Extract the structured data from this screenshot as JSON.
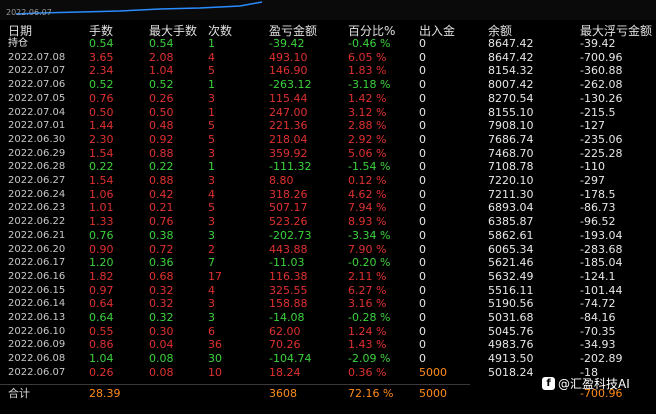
{
  "top_date": "2022.06.07",
  "headers": [
    "日期",
    "手数",
    "最大手数",
    "次数",
    "盈亏金额",
    "百分比%",
    "出入金",
    "余额",
    "最大浮亏金额"
  ],
  "rows": [
    {
      "date": "持仓",
      "lots": "0.54",
      "max_lots": "0.54",
      "count": "1",
      "pnl": "-39.42",
      "pct": "-0.46 %",
      "inout": "0",
      "balance": "8647.42",
      "max_float_loss": "-39.42",
      "pos": false
    },
    {
      "date": "2022.07.08",
      "lots": "3.65",
      "max_lots": "2.08",
      "count": "4",
      "pnl": "493.10",
      "pct": "6.05 %",
      "inout": "0",
      "balance": "8647.42",
      "max_float_loss": "-700.96",
      "pos": true
    },
    {
      "date": "2022.07.07",
      "lots": "2.34",
      "max_lots": "1.04",
      "count": "5",
      "pnl": "146.90",
      "pct": "1.83 %",
      "inout": "0",
      "balance": "8154.32",
      "max_float_loss": "-360.88",
      "pos": true
    },
    {
      "date": "2022.07.06",
      "lots": "0.52",
      "max_lots": "0.52",
      "count": "1",
      "pnl": "-263.12",
      "pct": "-3.18 %",
      "inout": "0",
      "balance": "8007.42",
      "max_float_loss": "-262.08",
      "pos": false
    },
    {
      "date": "2022.07.05",
      "lots": "0.76",
      "max_lots": "0.26",
      "count": "3",
      "pnl": "115.44",
      "pct": "1.42 %",
      "inout": "0",
      "balance": "8270.54",
      "max_float_loss": "-130.26",
      "pos": true
    },
    {
      "date": "2022.07.04",
      "lots": "0.50",
      "max_lots": "0.50",
      "count": "1",
      "pnl": "247.00",
      "pct": "3.12 %",
      "inout": "0",
      "balance": "8155.10",
      "max_float_loss": "-215.5",
      "pos": true
    },
    {
      "date": "2022.07.01",
      "lots": "1.44",
      "max_lots": "0.48",
      "count": "5",
      "pnl": "221.36",
      "pct": "2.88 %",
      "inout": "0",
      "balance": "7908.10",
      "max_float_loss": "-127",
      "pos": true
    },
    {
      "date": "2022.06.30",
      "lots": "2.30",
      "max_lots": "0.92",
      "count": "5",
      "pnl": "218.04",
      "pct": "2.92 %",
      "inout": "0",
      "balance": "7686.74",
      "max_float_loss": "-235.06",
      "pos": true
    },
    {
      "date": "2022.06.29",
      "lots": "1.54",
      "max_lots": "0.88",
      "count": "3",
      "pnl": "359.92",
      "pct": "5.06 %",
      "inout": "0",
      "balance": "7468.70",
      "max_float_loss": "-225.28",
      "pos": true
    },
    {
      "date": "2022.06.28",
      "lots": "0.22",
      "max_lots": "0.22",
      "count": "1",
      "pnl": "-111.32",
      "pct": "-1.54 %",
      "inout": "0",
      "balance": "7108.78",
      "max_float_loss": "-110",
      "pos": false
    },
    {
      "date": "2022.06.27",
      "lots": "1.54",
      "max_lots": "0.88",
      "count": "3",
      "pnl": "8.80",
      "pct": "0.12 %",
      "inout": "0",
      "balance": "7220.10",
      "max_float_loss": "-297",
      "pos": true
    },
    {
      "date": "2022.06.24",
      "lots": "1.06",
      "max_lots": "0.42",
      "count": "4",
      "pnl": "318.26",
      "pct": "4.62 %",
      "inout": "0",
      "balance": "7211.30",
      "max_float_loss": "-178.5",
      "pos": true
    },
    {
      "date": "2022.06.23",
      "lots": "1.01",
      "max_lots": "0.21",
      "count": "5",
      "pnl": "507.17",
      "pct": "7.94 %",
      "inout": "0",
      "balance": "6893.04",
      "max_float_loss": "-86.73",
      "pos": true
    },
    {
      "date": "2022.06.22",
      "lots": "1.33",
      "max_lots": "0.76",
      "count": "3",
      "pnl": "523.26",
      "pct": "8.93 %",
      "inout": "0",
      "balance": "6385.87",
      "max_float_loss": "-96.52",
      "pos": true
    },
    {
      "date": "2022.06.21",
      "lots": "0.76",
      "max_lots": "0.38",
      "count": "3",
      "pnl": "-202.73",
      "pct": "-3.34 %",
      "inout": "0",
      "balance": "5862.61",
      "max_float_loss": "-193.04",
      "pos": false
    },
    {
      "date": "2022.06.20",
      "lots": "0.90",
      "max_lots": "0.72",
      "count": "2",
      "pnl": "443.88",
      "pct": "7.90 %",
      "inout": "0",
      "balance": "6065.34",
      "max_float_loss": "-283.68",
      "pos": true
    },
    {
      "date": "2022.06.17",
      "lots": "1.20",
      "max_lots": "0.36",
      "count": "7",
      "pnl": "-11.03",
      "pct": "-0.20 %",
      "inout": "0",
      "balance": "5621.46",
      "max_float_loss": "-185.04",
      "pos": false
    },
    {
      "date": "2022.06.16",
      "lots": "1.82",
      "max_lots": "0.68",
      "count": "17",
      "pnl": "116.38",
      "pct": "2.11 %",
      "inout": "0",
      "balance": "5632.49",
      "max_float_loss": "-124.1",
      "pos": true
    },
    {
      "date": "2022.06.15",
      "lots": "0.97",
      "max_lots": "0.32",
      "count": "4",
      "pnl": "325.55",
      "pct": "6.27 %",
      "inout": "0",
      "balance": "5516.11",
      "max_float_loss": "-101.44",
      "pos": true
    },
    {
      "date": "2022.06.14",
      "lots": "0.64",
      "max_lots": "0.32",
      "count": "3",
      "pnl": "158.88",
      "pct": "3.16 %",
      "inout": "0",
      "balance": "5190.56",
      "max_float_loss": "-74.72",
      "pos": true
    },
    {
      "date": "2022.06.13",
      "lots": "0.64",
      "max_lots": "0.32",
      "count": "3",
      "pnl": "-14.08",
      "pct": "-0.28 %",
      "inout": "0",
      "balance": "5031.68",
      "max_float_loss": "-84.16",
      "pos": false
    },
    {
      "date": "2022.06.10",
      "lots": "0.55",
      "max_lots": "0.30",
      "count": "6",
      "pnl": "62.00",
      "pct": "1.24 %",
      "inout": "0",
      "balance": "5045.76",
      "max_float_loss": "-70.35",
      "pos": true
    },
    {
      "date": "2022.06.09",
      "lots": "0.86",
      "max_lots": "0.04",
      "count": "36",
      "pnl": "70.26",
      "pct": "1.43 %",
      "inout": "0",
      "balance": "4983.76",
      "max_float_loss": "-34.93",
      "pos": true
    },
    {
      "date": "2022.06.08",
      "lots": "1.04",
      "max_lots": "0.08",
      "count": "30",
      "pnl": "-104.74",
      "pct": "-2.09 %",
      "inout": "0",
      "balance": "4913.50",
      "max_float_loss": "-202.89",
      "pos": false
    },
    {
      "date": "2022.06.07",
      "lots": "0.26",
      "max_lots": "0.08",
      "count": "10",
      "pnl": "18.24",
      "pct": "0.36 %",
      "inout": "5000",
      "balance": "5018.24",
      "max_float_loss": "-18",
      "pos": true
    }
  ],
  "total": {
    "label": "合计",
    "lots": "28.39",
    "pnl": "3608",
    "pct": "72.16 %",
    "inout": "5000",
    "max_float_loss": "-700.96"
  },
  "watermark": {
    "icon": "f",
    "text": "@汇盈科技AI"
  },
  "colors": {
    "positive": "#e03030",
    "negative": "#3cd23c",
    "total": "#ff8c1a",
    "background": "#000000"
  }
}
